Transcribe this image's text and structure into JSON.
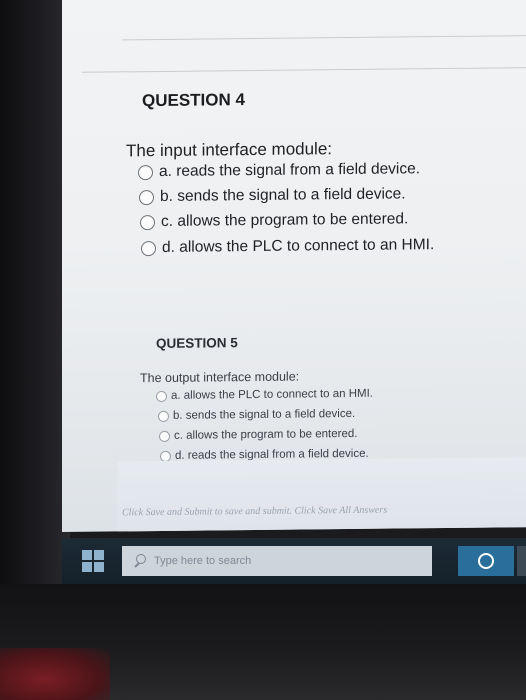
{
  "question4": {
    "title": "QUESTION 4",
    "text": "The input interface module:",
    "options": [
      "a. reads the signal from a field device.",
      "b. sends the signal to a field device.",
      "c. allows the program to be entered.",
      "d. allows the PLC to connect to an HMI."
    ]
  },
  "question5": {
    "title": "QUESTION 5",
    "text": "The output interface module:",
    "options": [
      "a. allows the PLC to connect to an HMI.",
      "b. sends the signal to a field device.",
      "c. allows the program to be entered.",
      "d. reads the signal from a field device."
    ]
  },
  "footer": {
    "text": "Click Save and Submit to save and submit. Click Save All Answers"
  },
  "taskbar": {
    "search_placeholder": "Type here to search"
  }
}
